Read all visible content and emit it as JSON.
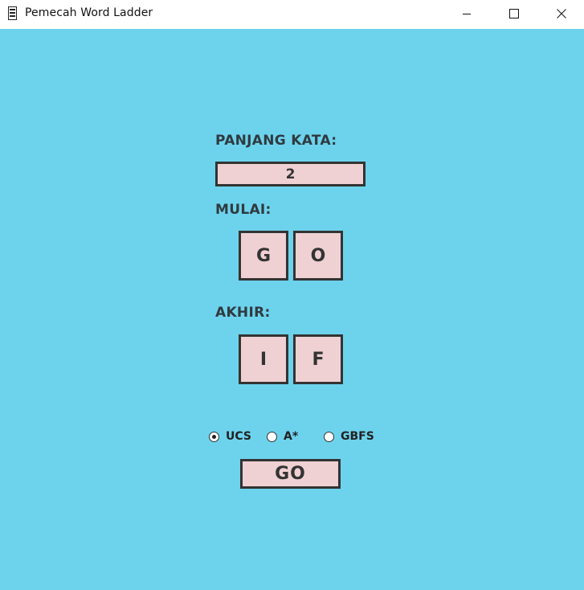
{
  "window": {
    "title": "Pemecah Word Ladder"
  },
  "form": {
    "length_label": "PANJANG KATA:",
    "length_value": "2",
    "start_label": "MULAI:",
    "start_letters": [
      "G",
      "O"
    ],
    "end_label": "AKHIR:",
    "end_letters": [
      "I",
      "F"
    ],
    "algorithms": [
      {
        "label": "UCS",
        "selected": true
      },
      {
        "label": "A*",
        "selected": false
      },
      {
        "label": "GBFS",
        "selected": false
      }
    ],
    "go_label": "GO"
  },
  "colors": {
    "background": "#6dd3ed",
    "box_fill": "#efd0d3",
    "border": "#333333"
  }
}
